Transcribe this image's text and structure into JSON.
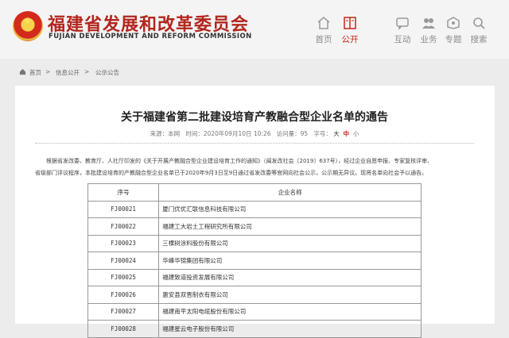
{
  "header": {
    "title": "福建省发展和改革委员会",
    "subtitle": "FUJIAN DEVELOPMENT AND REFORM COMMISSION",
    "nav": [
      {
        "label": "首页",
        "icon": "home-icon",
        "active": false
      },
      {
        "label": "公开",
        "icon": "book-icon",
        "active": true
      },
      {
        "label": "互动",
        "icon": "chat-icon",
        "active": false
      },
      {
        "label": "业务",
        "icon": "people-icon",
        "active": false
      },
      {
        "label": "专题",
        "icon": "topic-icon",
        "active": false
      },
      {
        "label": "搜索",
        "icon": "search-icon",
        "active": false
      }
    ],
    "accent_color": "#c0281d"
  },
  "breadcrumb": {
    "home": "首页",
    "sep": ">",
    "level2": "信息公开",
    "level3": "公示公告"
  },
  "article": {
    "title": "关于福建省第二批建设培育产教融合型企业名单的通告",
    "meta": {
      "source": "来源：本网",
      "time": "时间：2020年09月10日 10:26",
      "views": "访问量：95",
      "font_label": "字号：",
      "font_large": "大",
      "font_medium": "中",
      "font_small": "小"
    },
    "paragraph_line1": "根据省发改委、教育厅、人社厅印发的《关于开展产教融合型企业建设培育工作的通知》（闽发改社会〔2019〕637号），经过企业自愿申报、专家复核评审、",
    "paragraph_line2": "省级部门评议程序，本批建设培育的产教融合型企业名单已于2020年9月3日至9日通过省发改委等官网向社会公示，公示期无异议。现将名单向社会予以通告。",
    "table": {
      "headers": [
        "序号",
        "企业名称"
      ],
      "rows": [
        {
          "code": "FJ00021",
          "name": "厦门优优汇联信息科技有限公司"
        },
        {
          "code": "FJ00022",
          "name": "福建工大岩土工程研究所有限公司"
        },
        {
          "code": "FJ00023",
          "name": "三棵树涂料股份有限公司"
        },
        {
          "code": "FJ00024",
          "name": "华峰华锦集团有限公司"
        },
        {
          "code": "FJ00025",
          "name": "福建致道投资发展有限公司"
        },
        {
          "code": "FJ00026",
          "name": "惠安县双晋制衣有限公司"
        },
        {
          "code": "FJ00027",
          "name": "福建南平太阳电缆股份有限公司"
        },
        {
          "code": "FJ00028",
          "name": "福建星云电子股份有限公司"
        }
      ]
    }
  }
}
